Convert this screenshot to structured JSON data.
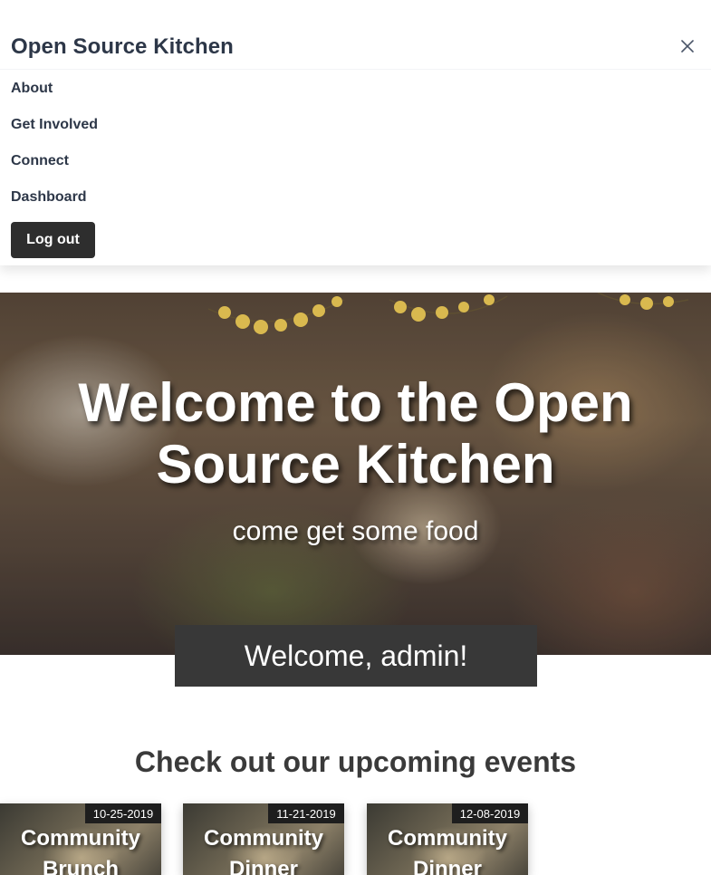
{
  "header": {
    "brand": "Open Source Kitchen",
    "close_icon": "close-icon"
  },
  "nav": {
    "items": [
      {
        "label": "About"
      },
      {
        "label": "Get Involved"
      },
      {
        "label": "Connect"
      },
      {
        "label": "Dashboard"
      }
    ],
    "logout_label": "Log out"
  },
  "hero": {
    "title": "Welcome to the Open Source Kitchen",
    "subtitle": "come get some food",
    "welcome_message": "Welcome, admin!"
  },
  "events": {
    "heading": "Check out our upcoming events",
    "items": [
      {
        "date": "10-25-2019",
        "title": "Community Brunch"
      },
      {
        "date": "11-21-2019",
        "title": "Community Dinner"
      },
      {
        "date": "12-08-2019",
        "title": "Community Dinner"
      }
    ]
  },
  "colors": {
    "brand_text": "#2d3748",
    "button_dark": "#2e2e2e",
    "welcome_box": "#383838",
    "date_badge": "#1e1e1e"
  }
}
